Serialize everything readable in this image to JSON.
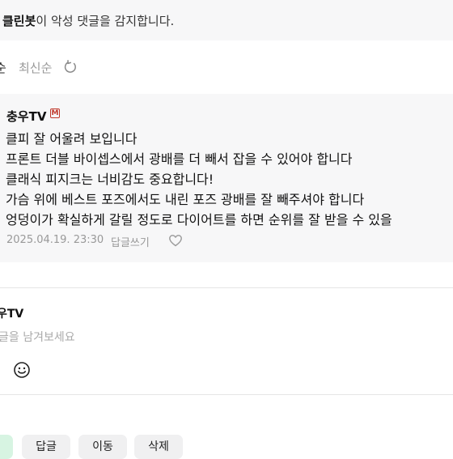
{
  "notice": {
    "bot_name": "클린봇",
    "message": "이 악성 댓글을 감지합니다."
  },
  "sort": {
    "registered_label": "순",
    "latest_label": "최신순",
    "refresh_icon": "refresh-icon"
  },
  "comment": {
    "author": "충우TV",
    "badge": "M",
    "lines": [
      "클피 잘 어울려 보입니다",
      "프론트 더블 바이셉스에서 광배를 더 빼서 잡을 수 있어야 합니다",
      "클래식 피지크는 너비감도 중요합니다!",
      "가슴 위에 베스트 포즈에서도 내린 포즈 광배를 잘 빼주셔야 합니다",
      "엉덩이가 확실하게 갈릴 정도로 다이어트를 하면 순위를 잘 받을 수 있을"
    ],
    "date": "2025.04.19. 23:30",
    "reply_label": "답글쓰기",
    "like_icon": "heart-icon"
  },
  "writer": {
    "name": "우TV",
    "placeholder": "글을 남겨보세요",
    "emoji_icon": "smile-icon"
  },
  "buttons": {
    "reply": "답글",
    "move": "이동",
    "delete": "삭제"
  },
  "colors": {
    "panel_bg": "#f7f7f8",
    "muted_text": "#999999",
    "badge_red": "#c0392b",
    "accent_green": "#d7f4e2"
  }
}
